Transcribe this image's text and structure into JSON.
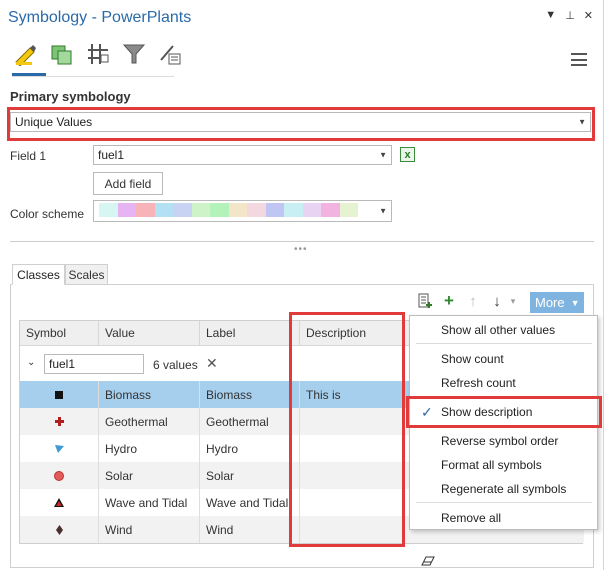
{
  "window": {
    "title": "Symbology - PowerPlants",
    "controls": [
      "▼",
      "⊥",
      "✕"
    ]
  },
  "toolbar_tabs": [
    {
      "icon": "pencil-icon"
    },
    {
      "icon": "vary-symbology-icon"
    },
    {
      "icon": "label-grid-icon"
    },
    {
      "icon": "filter-icon"
    },
    {
      "icon": "pen-list-icon"
    }
  ],
  "primary": {
    "label": "Primary symbology",
    "value": "Unique Values"
  },
  "field1": {
    "label": "Field 1",
    "value": "fuel1",
    "add_field": "Add field"
  },
  "color_scheme": {
    "label": "Color scheme",
    "colors": [
      "#d7f6f3",
      "#e6b3f3",
      "#f7b3b8",
      "#b3e0f3",
      "#c8d3f3",
      "#cff3c8",
      "#b3f3b9",
      "#f3e6c8",
      "#f3d8e0",
      "#c0c6f3",
      "#c8eff3",
      "#e9d3f3",
      "#f3b3e0",
      "#e6f3d0"
    ]
  },
  "class_tabs": {
    "classes": "Classes",
    "scales": "Scales"
  },
  "more_button": "More",
  "columns": {
    "symbol": "Symbol",
    "value": "Value",
    "label": "Label",
    "description": "Description"
  },
  "group": {
    "field": "fuel1",
    "count": "6 values"
  },
  "rows": [
    {
      "value": "Biomass",
      "label": "Biomass",
      "description": "This is",
      "symbol": "black-square"
    },
    {
      "value": "Geothermal",
      "label": "Geothermal",
      "description": "",
      "symbol": "red-cross"
    },
    {
      "value": "Hydro",
      "label": "Hydro",
      "description": "",
      "symbol": "blue-triangle-down"
    },
    {
      "value": "Solar",
      "label": "Solar",
      "description": "",
      "symbol": "red-circle"
    },
    {
      "value": "Wave and Tidal",
      "label": "Wave and Tidal",
      "description": "",
      "symbol": "red-black-triangle"
    },
    {
      "value": "Wind",
      "label": "Wind",
      "description": "",
      "symbol": "dark-diamond"
    }
  ],
  "more_menu": {
    "show_all_other_values": "Show all other values",
    "show_count": "Show count",
    "refresh_count": "Refresh count",
    "show_description": "Show description",
    "reverse_symbol_order": "Reverse symbol order",
    "format_all_symbols": "Format all symbols",
    "regenerate_all_symbols": "Regenerate all symbols",
    "remove_all": "Remove all"
  },
  "colors": {
    "title": "#2b6aa8",
    "highlight": "#e03a3a",
    "selected_row": "#a6cfee",
    "more_button": "#7fb3e0"
  }
}
